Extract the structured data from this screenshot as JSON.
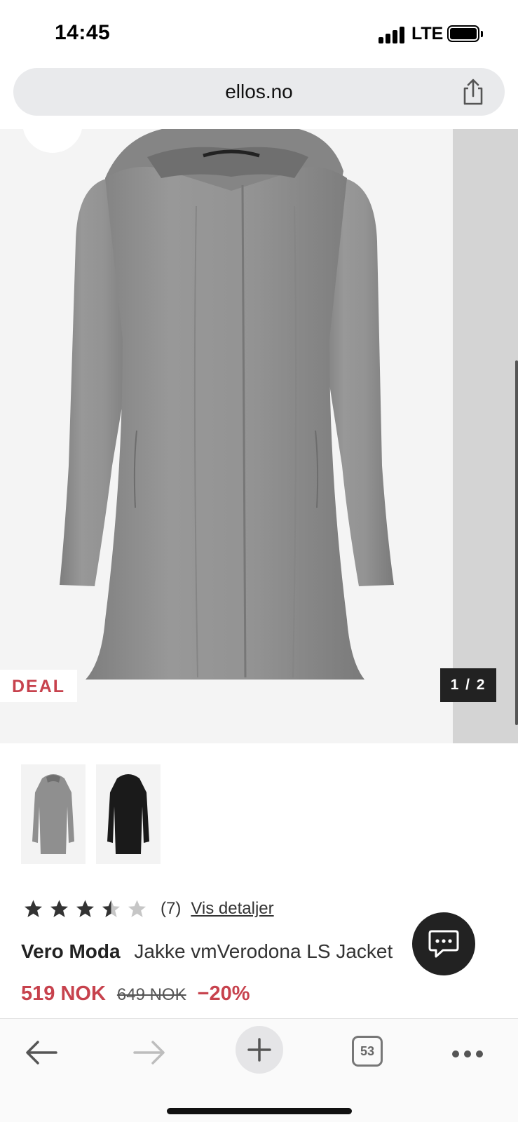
{
  "status_bar": {
    "time": "14:45",
    "carrier": "LTE"
  },
  "browser": {
    "url": "ellos.no",
    "share_icon": "share-icon"
  },
  "gallery": {
    "badge": "DEAL",
    "counter": "1 / 2",
    "colors": {
      "grey": "#8f8f8f",
      "black": "#1a1a1a"
    }
  },
  "product": {
    "rating_value": 3.5,
    "rating_max": 5,
    "review_count": "(7)",
    "details_link": "Vis detaljer",
    "brand": "Vero Moda",
    "name": "Jakke vmVerodona LS Jacket",
    "price": "519 NOK",
    "old_price": "649 NOK",
    "discount": "−20%",
    "accent_color": "#c7424d"
  },
  "toolbar": {
    "tabs_count": "53"
  }
}
